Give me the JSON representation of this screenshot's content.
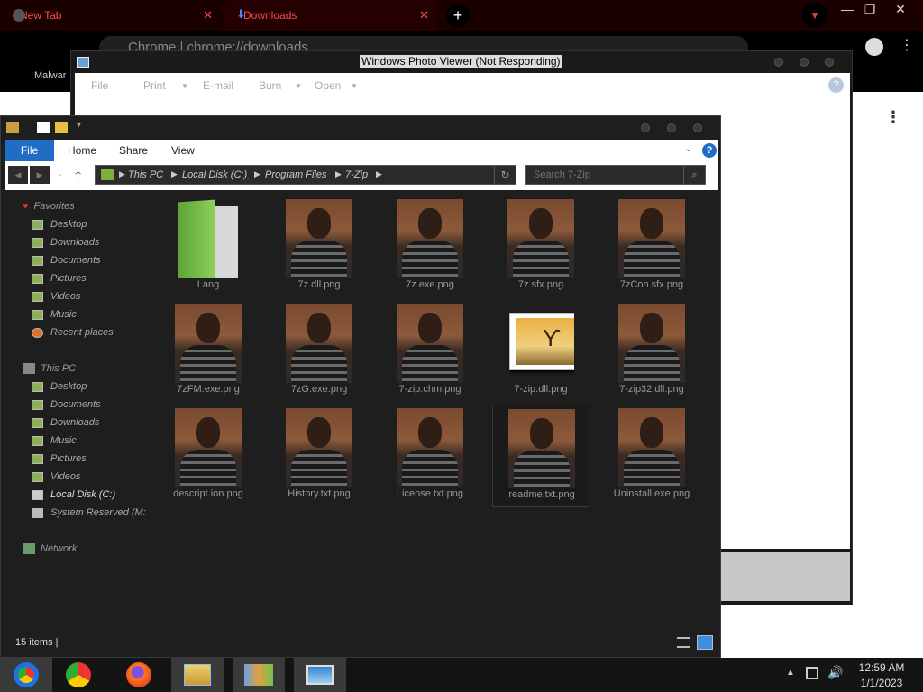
{
  "chrome": {
    "tabs": [
      {
        "label": "New Tab"
      },
      {
        "label": "Downloads"
      }
    ],
    "omnibox": "Chrome  |  chrome://downloads",
    "bookmark_label": "Malwar",
    "accent_color": "#ff4b4b"
  },
  "photo_viewer": {
    "title": "Windows Photo Viewer (Not Responding)",
    "menu": [
      {
        "label": "File"
      },
      {
        "label": "Print"
      },
      {
        "label": "E-mail"
      },
      {
        "label": "Burn"
      },
      {
        "label": "Open"
      }
    ]
  },
  "explorer": {
    "ribbon_tabs": [
      {
        "label": "File"
      },
      {
        "label": "Home"
      },
      {
        "label": "Share"
      },
      {
        "label": "View"
      }
    ],
    "breadcrumb": [
      {
        "label": "This PC"
      },
      {
        "label": "Local Disk (C:)"
      },
      {
        "label": "Program Files"
      },
      {
        "label": "7-Zip"
      }
    ],
    "search_placeholder": "Search 7-Zip",
    "nav": {
      "favorites": "Favorites",
      "fav_items": [
        {
          "label": "Desktop"
        },
        {
          "label": "Downloads"
        },
        {
          "label": "Documents"
        },
        {
          "label": "Pictures"
        },
        {
          "label": "Videos"
        },
        {
          "label": "Music"
        },
        {
          "label": "Recent places"
        }
      ],
      "this_pc": "This PC",
      "pc_items": [
        {
          "label": "Desktop"
        },
        {
          "label": "Documents"
        },
        {
          "label": "Downloads"
        },
        {
          "label": "Music"
        },
        {
          "label": "Pictures"
        },
        {
          "label": "Videos"
        },
        {
          "label": "Local Disk (C:)"
        },
        {
          "label": "System Reserved (M:"
        }
      ],
      "network": "Network"
    },
    "files": [
      {
        "name": "Lang",
        "kind": "folder"
      },
      {
        "name": "7z.dll.png",
        "kind": "photo"
      },
      {
        "name": "7z.exe.png",
        "kind": "photo"
      },
      {
        "name": "7z.sfx.png",
        "kind": "photo"
      },
      {
        "name": "7zCon.sfx.png",
        "kind": "photo"
      },
      {
        "name": "7zFM.exe.png",
        "kind": "photo"
      },
      {
        "name": "7zG.exe.png",
        "kind": "photo"
      },
      {
        "name": "7-zip.chm.png",
        "kind": "photo"
      },
      {
        "name": "7-zip.dll.png",
        "kind": "generic-image"
      },
      {
        "name": "7-zip32.dll.png",
        "kind": "photo"
      },
      {
        "name": "descript.ion.png",
        "kind": "photo"
      },
      {
        "name": "History.txt.png",
        "kind": "photo"
      },
      {
        "name": "License.txt.png",
        "kind": "photo"
      },
      {
        "name": "readme.txt.png",
        "kind": "photo"
      },
      {
        "name": "Uninstall.exe.png",
        "kind": "photo"
      }
    ],
    "status": "15 items"
  },
  "taskbar": {
    "apps": [
      {
        "icon": "chrome-remote-icon"
      },
      {
        "icon": "chrome-icon"
      },
      {
        "icon": "firefox-icon"
      },
      {
        "icon": "file-explorer-icon"
      },
      {
        "icon": "people-app-icon"
      },
      {
        "icon": "photo-viewer-icon"
      }
    ],
    "time": "12:59 AM",
    "date": "1/1/2023"
  }
}
